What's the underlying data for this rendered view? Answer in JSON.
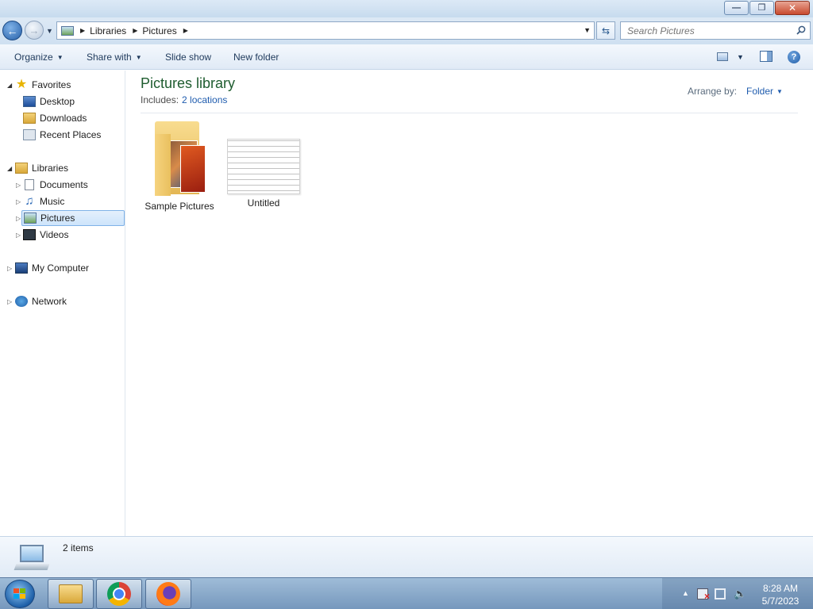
{
  "window": {
    "minimize_glyph": "—",
    "restore_glyph": "❐",
    "close_glyph": "✕"
  },
  "navbar": {
    "breadcrumbs": [
      "Libraries",
      "Pictures"
    ],
    "search_placeholder": "Search Pictures"
  },
  "toolbar": {
    "organize": "Organize",
    "share_with": "Share with",
    "slide_show": "Slide show",
    "new_folder": "New folder",
    "help_glyph": "?"
  },
  "sidebar": {
    "favorites": {
      "label": "Favorites",
      "items": [
        "Desktop",
        "Downloads",
        "Recent Places"
      ]
    },
    "libraries": {
      "label": "Libraries",
      "items": [
        "Documents",
        "Music",
        "Pictures",
        "Videos"
      ],
      "selected": "Pictures"
    },
    "computer": "My Computer",
    "network": "Network"
  },
  "library": {
    "title": "Pictures library",
    "includes_label": "Includes:",
    "includes_link": "2 locations",
    "arrange_label": "Arrange by:",
    "arrange_value": "Folder"
  },
  "items": [
    {
      "name": "Sample Pictures",
      "type": "folder"
    },
    {
      "name": "Untitled",
      "type": "image"
    }
  ],
  "details": {
    "count": "2 items"
  },
  "taskbar": {
    "apps": [
      "Windows Explorer",
      "Google Chrome",
      "Mozilla Firefox"
    ],
    "time": "8:28 AM",
    "date": "5/7/2023"
  },
  "colors": {
    "library_title": "#1e5c2f",
    "link": "#1f5cae",
    "selection": "#cde4fb"
  }
}
